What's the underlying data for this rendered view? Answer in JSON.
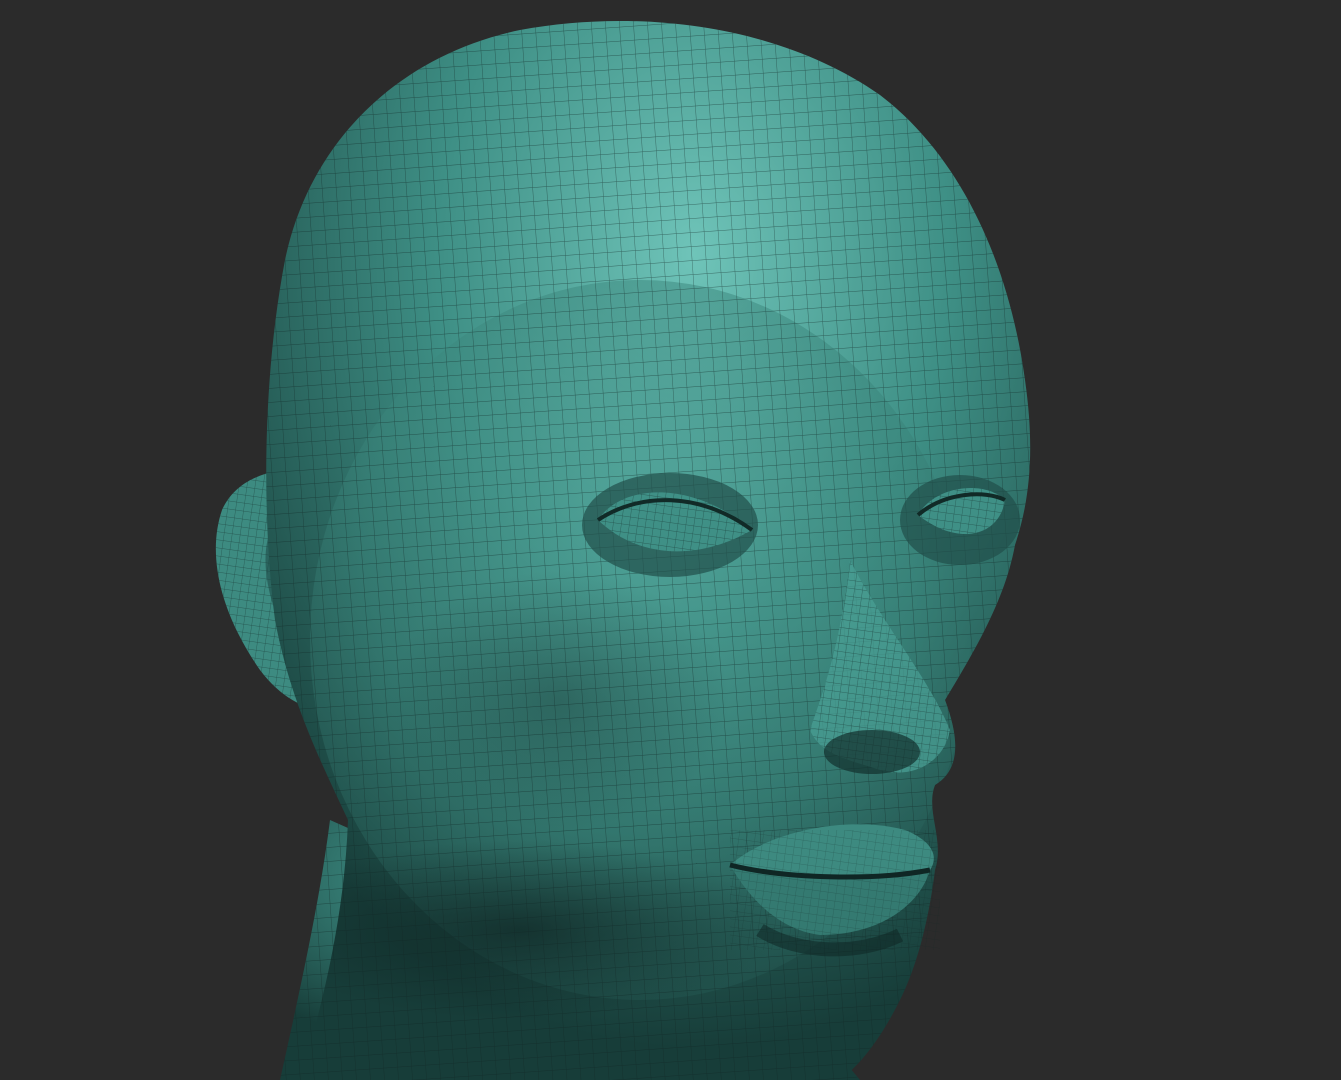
{
  "viewport": {
    "background_color": "#2b2b2b"
  },
  "model": {
    "subject": "bust-head",
    "material_base_color": "#3e8f85",
    "material_highlight_color": "#6fc4b9",
    "material_shadow_color": "#173d39",
    "wireframe_color": "#102624",
    "wireframe_visible": true
  }
}
